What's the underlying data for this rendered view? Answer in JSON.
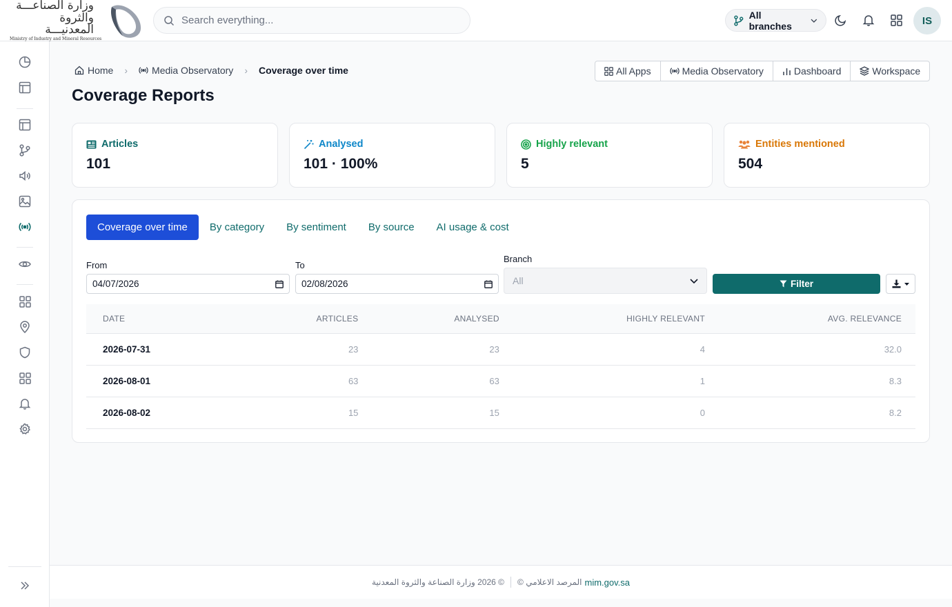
{
  "logo": {
    "ar_line1": "وزارة الصناعـــة",
    "ar_line2": "والثروة المعدنيـــة",
    "en_line": "Ministry of Industry and Mineral Resources"
  },
  "search": {
    "placeholder": "Search everything..."
  },
  "header": {
    "branch_label": "All branches",
    "avatar_initials": "IS"
  },
  "breadcrumb": {
    "home": "Home",
    "section": "Media Observatory",
    "current": "Coverage over time"
  },
  "quicklinks": [
    "All Apps",
    "Media Observatory",
    "Dashboard",
    "Workspace"
  ],
  "page_title": "Coverage Reports",
  "stats": [
    {
      "label": "Articles",
      "value": "101",
      "color": "#0f6b6b",
      "icon": "newspaper-icon"
    },
    {
      "label": "Analysed",
      "value": "101 · 100%",
      "color": "#0e87c9",
      "icon": "magic-wand-icon"
    },
    {
      "label": "Highly relevant",
      "value": "5",
      "color": "#16a34a",
      "icon": "target-icon"
    },
    {
      "label": "Entities mentioned",
      "value": "504",
      "color": "#d97706",
      "icon": "users-icon"
    }
  ],
  "tabs": [
    "Coverage over time",
    "By category",
    "By sentiment",
    "By source",
    "AI usage & cost"
  ],
  "filters": {
    "from_label": "From",
    "from_value": "04/07/2026",
    "to_label": "To",
    "to_value": "02/08/2026",
    "branch_label": "Branch",
    "branch_value": "All",
    "filter_button": "Filter"
  },
  "table": {
    "headers": [
      "DATE",
      "ARTICLES",
      "ANALYSED",
      "HIGHLY RELEVANT",
      "AVG. RELEVANCE"
    ],
    "rows": [
      [
        "2026-07-31",
        "23",
        "23",
        "4",
        "32.0"
      ],
      [
        "2026-08-01",
        "63",
        "63",
        "1",
        "8.3"
      ],
      [
        "2026-08-02",
        "15",
        "15",
        "0",
        "8.2"
      ]
    ]
  },
  "footer": {
    "copyright": "© 2026 وزارة الصناعة والثروة المعدنية",
    "observatory": "المرصد الاعلامي ©",
    "link": "mim.gov.sa"
  },
  "colors": {
    "accent": "#0f6b6b",
    "active_tab": "#1d4ed8"
  }
}
